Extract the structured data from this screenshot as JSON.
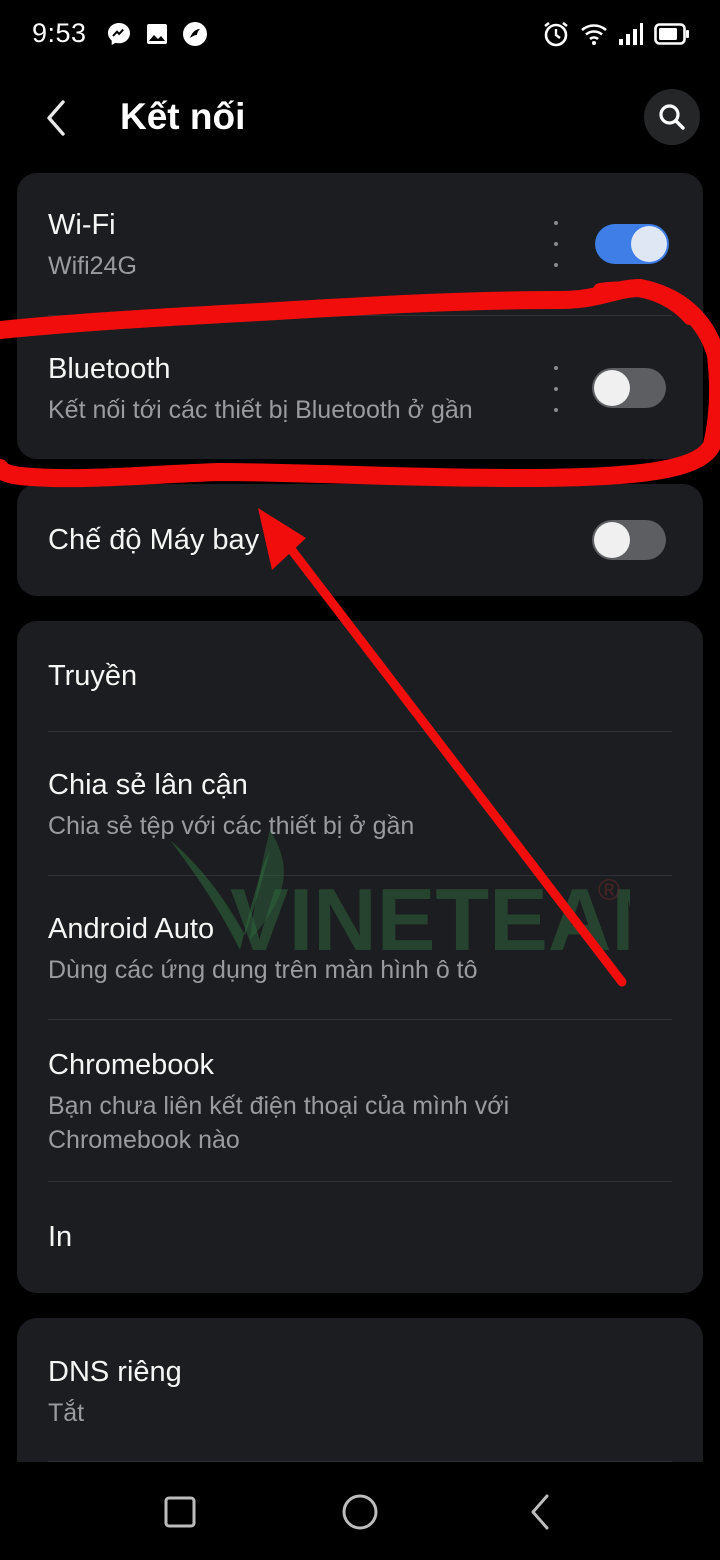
{
  "status_bar": {
    "time": "9:53",
    "notification_icons": [
      "messenger-icon",
      "gallery-icon",
      "app-notification-icon"
    ],
    "system_icons": [
      "alarm-icon",
      "wifi-icon",
      "signal-icon",
      "battery-icon"
    ]
  },
  "app_bar": {
    "title": "Kết nối",
    "back_icon": "back-arrow-icon",
    "search_icon": "search-icon"
  },
  "group1": {
    "wifi": {
      "title": "Wi-Fi",
      "subtitle": "Wifi24G",
      "toggle_on": true
    },
    "bluetooth": {
      "title": "Bluetooth",
      "subtitle": "Kết nối tới các thiết bị Bluetooth ở gần",
      "toggle_on": false
    }
  },
  "group2": {
    "airplane": {
      "title": "Chế độ Máy bay",
      "toggle_on": false
    }
  },
  "group3": {
    "items": [
      {
        "title": "Truyền"
      },
      {
        "title": "Chia sẻ lân cận",
        "subtitle": "Chia sẻ tệp với các thiết bị ở gần"
      },
      {
        "title": "Android Auto",
        "subtitle": "Dùng các ứng dụng trên màn hình ô tô"
      },
      {
        "title": "Chromebook",
        "subtitle": "Bạn chưa liên kết điện thoại của mình với Chromebook nào"
      },
      {
        "title": "In"
      }
    ]
  },
  "group4": {
    "dns": {
      "title": "DNS riêng",
      "subtitle": "Tắt"
    }
  },
  "watermark": {
    "text": "VINETEAM",
    "mark": "®"
  },
  "nav_bar": {
    "icons": [
      "recent-apps-icon",
      "home-icon",
      "back-icon"
    ]
  },
  "colors": {
    "background": "#000000",
    "card": "#1c1d20",
    "accent": "#3e7ee6",
    "annotation": "#f20d0d",
    "watermark": "#2f6a3d"
  }
}
